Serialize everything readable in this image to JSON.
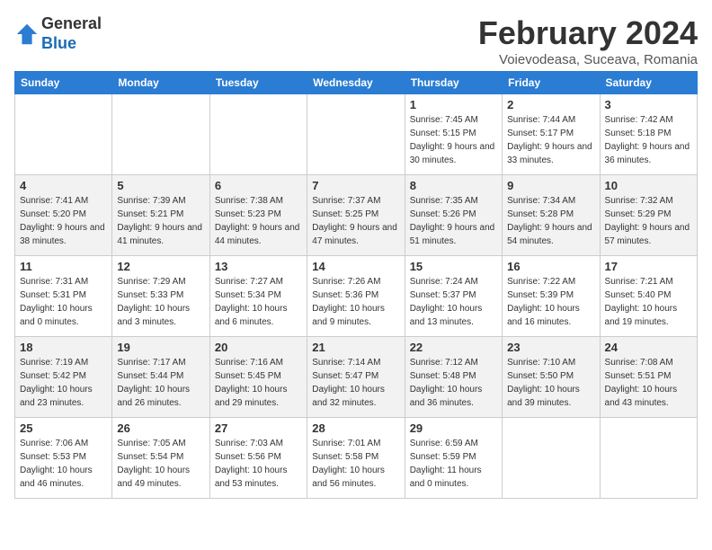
{
  "header": {
    "logo_general": "General",
    "logo_blue": "Blue",
    "month_title": "February 2024",
    "subtitle": "Voievodeasa, Suceava, Romania"
  },
  "weekdays": [
    "Sunday",
    "Monday",
    "Tuesday",
    "Wednesday",
    "Thursday",
    "Friday",
    "Saturday"
  ],
  "weeks": [
    [
      {
        "day": "",
        "sunrise": "",
        "sunset": "",
        "daylight": ""
      },
      {
        "day": "",
        "sunrise": "",
        "sunset": "",
        "daylight": ""
      },
      {
        "day": "",
        "sunrise": "",
        "sunset": "",
        "daylight": ""
      },
      {
        "day": "",
        "sunrise": "",
        "sunset": "",
        "daylight": ""
      },
      {
        "day": "1",
        "sunrise": "Sunrise: 7:45 AM",
        "sunset": "Sunset: 5:15 PM",
        "daylight": "Daylight: 9 hours and 30 minutes."
      },
      {
        "day": "2",
        "sunrise": "Sunrise: 7:44 AM",
        "sunset": "Sunset: 5:17 PM",
        "daylight": "Daylight: 9 hours and 33 minutes."
      },
      {
        "day": "3",
        "sunrise": "Sunrise: 7:42 AM",
        "sunset": "Sunset: 5:18 PM",
        "daylight": "Daylight: 9 hours and 36 minutes."
      }
    ],
    [
      {
        "day": "4",
        "sunrise": "Sunrise: 7:41 AM",
        "sunset": "Sunset: 5:20 PM",
        "daylight": "Daylight: 9 hours and 38 minutes."
      },
      {
        "day": "5",
        "sunrise": "Sunrise: 7:39 AM",
        "sunset": "Sunset: 5:21 PM",
        "daylight": "Daylight: 9 hours and 41 minutes."
      },
      {
        "day": "6",
        "sunrise": "Sunrise: 7:38 AM",
        "sunset": "Sunset: 5:23 PM",
        "daylight": "Daylight: 9 hours and 44 minutes."
      },
      {
        "day": "7",
        "sunrise": "Sunrise: 7:37 AM",
        "sunset": "Sunset: 5:25 PM",
        "daylight": "Daylight: 9 hours and 47 minutes."
      },
      {
        "day": "8",
        "sunrise": "Sunrise: 7:35 AM",
        "sunset": "Sunset: 5:26 PM",
        "daylight": "Daylight: 9 hours and 51 minutes."
      },
      {
        "day": "9",
        "sunrise": "Sunrise: 7:34 AM",
        "sunset": "Sunset: 5:28 PM",
        "daylight": "Daylight: 9 hours and 54 minutes."
      },
      {
        "day": "10",
        "sunrise": "Sunrise: 7:32 AM",
        "sunset": "Sunset: 5:29 PM",
        "daylight": "Daylight: 9 hours and 57 minutes."
      }
    ],
    [
      {
        "day": "11",
        "sunrise": "Sunrise: 7:31 AM",
        "sunset": "Sunset: 5:31 PM",
        "daylight": "Daylight: 10 hours and 0 minutes."
      },
      {
        "day": "12",
        "sunrise": "Sunrise: 7:29 AM",
        "sunset": "Sunset: 5:33 PM",
        "daylight": "Daylight: 10 hours and 3 minutes."
      },
      {
        "day": "13",
        "sunrise": "Sunrise: 7:27 AM",
        "sunset": "Sunset: 5:34 PM",
        "daylight": "Daylight: 10 hours and 6 minutes."
      },
      {
        "day": "14",
        "sunrise": "Sunrise: 7:26 AM",
        "sunset": "Sunset: 5:36 PM",
        "daylight": "Daylight: 10 hours and 9 minutes."
      },
      {
        "day": "15",
        "sunrise": "Sunrise: 7:24 AM",
        "sunset": "Sunset: 5:37 PM",
        "daylight": "Daylight: 10 hours and 13 minutes."
      },
      {
        "day": "16",
        "sunrise": "Sunrise: 7:22 AM",
        "sunset": "Sunset: 5:39 PM",
        "daylight": "Daylight: 10 hours and 16 minutes."
      },
      {
        "day": "17",
        "sunrise": "Sunrise: 7:21 AM",
        "sunset": "Sunset: 5:40 PM",
        "daylight": "Daylight: 10 hours and 19 minutes."
      }
    ],
    [
      {
        "day": "18",
        "sunrise": "Sunrise: 7:19 AM",
        "sunset": "Sunset: 5:42 PM",
        "daylight": "Daylight: 10 hours and 23 minutes."
      },
      {
        "day": "19",
        "sunrise": "Sunrise: 7:17 AM",
        "sunset": "Sunset: 5:44 PM",
        "daylight": "Daylight: 10 hours and 26 minutes."
      },
      {
        "day": "20",
        "sunrise": "Sunrise: 7:16 AM",
        "sunset": "Sunset: 5:45 PM",
        "daylight": "Daylight: 10 hours and 29 minutes."
      },
      {
        "day": "21",
        "sunrise": "Sunrise: 7:14 AM",
        "sunset": "Sunset: 5:47 PM",
        "daylight": "Daylight: 10 hours and 32 minutes."
      },
      {
        "day": "22",
        "sunrise": "Sunrise: 7:12 AM",
        "sunset": "Sunset: 5:48 PM",
        "daylight": "Daylight: 10 hours and 36 minutes."
      },
      {
        "day": "23",
        "sunrise": "Sunrise: 7:10 AM",
        "sunset": "Sunset: 5:50 PM",
        "daylight": "Daylight: 10 hours and 39 minutes."
      },
      {
        "day": "24",
        "sunrise": "Sunrise: 7:08 AM",
        "sunset": "Sunset: 5:51 PM",
        "daylight": "Daylight: 10 hours and 43 minutes."
      }
    ],
    [
      {
        "day": "25",
        "sunrise": "Sunrise: 7:06 AM",
        "sunset": "Sunset: 5:53 PM",
        "daylight": "Daylight: 10 hours and 46 minutes."
      },
      {
        "day": "26",
        "sunrise": "Sunrise: 7:05 AM",
        "sunset": "Sunset: 5:54 PM",
        "daylight": "Daylight: 10 hours and 49 minutes."
      },
      {
        "day": "27",
        "sunrise": "Sunrise: 7:03 AM",
        "sunset": "Sunset: 5:56 PM",
        "daylight": "Daylight: 10 hours and 53 minutes."
      },
      {
        "day": "28",
        "sunrise": "Sunrise: 7:01 AM",
        "sunset": "Sunset: 5:58 PM",
        "daylight": "Daylight: 10 hours and 56 minutes."
      },
      {
        "day": "29",
        "sunrise": "Sunrise: 6:59 AM",
        "sunset": "Sunset: 5:59 PM",
        "daylight": "Daylight: 11 hours and 0 minutes."
      },
      {
        "day": "",
        "sunrise": "",
        "sunset": "",
        "daylight": ""
      },
      {
        "day": "",
        "sunrise": "",
        "sunset": "",
        "daylight": ""
      }
    ]
  ]
}
